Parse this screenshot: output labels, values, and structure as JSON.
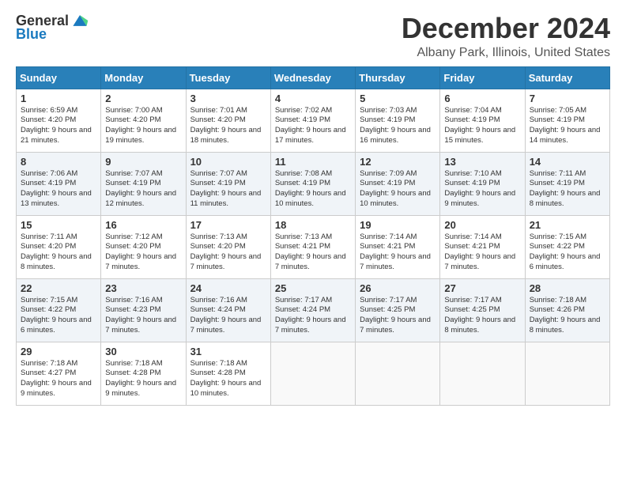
{
  "logo": {
    "general": "General",
    "blue": "Blue"
  },
  "title": "December 2024",
  "location": "Albany Park, Illinois, United States",
  "weekdays": [
    "Sunday",
    "Monday",
    "Tuesday",
    "Wednesday",
    "Thursday",
    "Friday",
    "Saturday"
  ],
  "weeks": [
    [
      {
        "day": "1",
        "sunrise": "Sunrise: 6:59 AM",
        "sunset": "Sunset: 4:20 PM",
        "daylight": "Daylight: 9 hours and 21 minutes."
      },
      {
        "day": "2",
        "sunrise": "Sunrise: 7:00 AM",
        "sunset": "Sunset: 4:20 PM",
        "daylight": "Daylight: 9 hours and 19 minutes."
      },
      {
        "day": "3",
        "sunrise": "Sunrise: 7:01 AM",
        "sunset": "Sunset: 4:20 PM",
        "daylight": "Daylight: 9 hours and 18 minutes."
      },
      {
        "day": "4",
        "sunrise": "Sunrise: 7:02 AM",
        "sunset": "Sunset: 4:19 PM",
        "daylight": "Daylight: 9 hours and 17 minutes."
      },
      {
        "day": "5",
        "sunrise": "Sunrise: 7:03 AM",
        "sunset": "Sunset: 4:19 PM",
        "daylight": "Daylight: 9 hours and 16 minutes."
      },
      {
        "day": "6",
        "sunrise": "Sunrise: 7:04 AM",
        "sunset": "Sunset: 4:19 PM",
        "daylight": "Daylight: 9 hours and 15 minutes."
      },
      {
        "day": "7",
        "sunrise": "Sunrise: 7:05 AM",
        "sunset": "Sunset: 4:19 PM",
        "daylight": "Daylight: 9 hours and 14 minutes."
      }
    ],
    [
      {
        "day": "8",
        "sunrise": "Sunrise: 7:06 AM",
        "sunset": "Sunset: 4:19 PM",
        "daylight": "Daylight: 9 hours and 13 minutes."
      },
      {
        "day": "9",
        "sunrise": "Sunrise: 7:07 AM",
        "sunset": "Sunset: 4:19 PM",
        "daylight": "Daylight: 9 hours and 12 minutes."
      },
      {
        "day": "10",
        "sunrise": "Sunrise: 7:07 AM",
        "sunset": "Sunset: 4:19 PM",
        "daylight": "Daylight: 9 hours and 11 minutes."
      },
      {
        "day": "11",
        "sunrise": "Sunrise: 7:08 AM",
        "sunset": "Sunset: 4:19 PM",
        "daylight": "Daylight: 9 hours and 10 minutes."
      },
      {
        "day": "12",
        "sunrise": "Sunrise: 7:09 AM",
        "sunset": "Sunset: 4:19 PM",
        "daylight": "Daylight: 9 hours and 10 minutes."
      },
      {
        "day": "13",
        "sunrise": "Sunrise: 7:10 AM",
        "sunset": "Sunset: 4:19 PM",
        "daylight": "Daylight: 9 hours and 9 minutes."
      },
      {
        "day": "14",
        "sunrise": "Sunrise: 7:11 AM",
        "sunset": "Sunset: 4:19 PM",
        "daylight": "Daylight: 9 hours and 8 minutes."
      }
    ],
    [
      {
        "day": "15",
        "sunrise": "Sunrise: 7:11 AM",
        "sunset": "Sunset: 4:20 PM",
        "daylight": "Daylight: 9 hours and 8 minutes."
      },
      {
        "day": "16",
        "sunrise": "Sunrise: 7:12 AM",
        "sunset": "Sunset: 4:20 PM",
        "daylight": "Daylight: 9 hours and 7 minutes."
      },
      {
        "day": "17",
        "sunrise": "Sunrise: 7:13 AM",
        "sunset": "Sunset: 4:20 PM",
        "daylight": "Daylight: 9 hours and 7 minutes."
      },
      {
        "day": "18",
        "sunrise": "Sunrise: 7:13 AM",
        "sunset": "Sunset: 4:21 PM",
        "daylight": "Daylight: 9 hours and 7 minutes."
      },
      {
        "day": "19",
        "sunrise": "Sunrise: 7:14 AM",
        "sunset": "Sunset: 4:21 PM",
        "daylight": "Daylight: 9 hours and 7 minutes."
      },
      {
        "day": "20",
        "sunrise": "Sunrise: 7:14 AM",
        "sunset": "Sunset: 4:21 PM",
        "daylight": "Daylight: 9 hours and 7 minutes."
      },
      {
        "day": "21",
        "sunrise": "Sunrise: 7:15 AM",
        "sunset": "Sunset: 4:22 PM",
        "daylight": "Daylight: 9 hours and 6 minutes."
      }
    ],
    [
      {
        "day": "22",
        "sunrise": "Sunrise: 7:15 AM",
        "sunset": "Sunset: 4:22 PM",
        "daylight": "Daylight: 9 hours and 6 minutes."
      },
      {
        "day": "23",
        "sunrise": "Sunrise: 7:16 AM",
        "sunset": "Sunset: 4:23 PM",
        "daylight": "Daylight: 9 hours and 7 minutes."
      },
      {
        "day": "24",
        "sunrise": "Sunrise: 7:16 AM",
        "sunset": "Sunset: 4:24 PM",
        "daylight": "Daylight: 9 hours and 7 minutes."
      },
      {
        "day": "25",
        "sunrise": "Sunrise: 7:17 AM",
        "sunset": "Sunset: 4:24 PM",
        "daylight": "Daylight: 9 hours and 7 minutes."
      },
      {
        "day": "26",
        "sunrise": "Sunrise: 7:17 AM",
        "sunset": "Sunset: 4:25 PM",
        "daylight": "Daylight: 9 hours and 7 minutes."
      },
      {
        "day": "27",
        "sunrise": "Sunrise: 7:17 AM",
        "sunset": "Sunset: 4:25 PM",
        "daylight": "Daylight: 9 hours and 8 minutes."
      },
      {
        "day": "28",
        "sunrise": "Sunrise: 7:18 AM",
        "sunset": "Sunset: 4:26 PM",
        "daylight": "Daylight: 9 hours and 8 minutes."
      }
    ],
    [
      {
        "day": "29",
        "sunrise": "Sunrise: 7:18 AM",
        "sunset": "Sunset: 4:27 PM",
        "daylight": "Daylight: 9 hours and 9 minutes."
      },
      {
        "day": "30",
        "sunrise": "Sunrise: 7:18 AM",
        "sunset": "Sunset: 4:28 PM",
        "daylight": "Daylight: 9 hours and 9 minutes."
      },
      {
        "day": "31",
        "sunrise": "Sunrise: 7:18 AM",
        "sunset": "Sunset: 4:28 PM",
        "daylight": "Daylight: 9 hours and 10 minutes."
      },
      {
        "day": "",
        "sunrise": "",
        "sunset": "",
        "daylight": ""
      },
      {
        "day": "",
        "sunrise": "",
        "sunset": "",
        "daylight": ""
      },
      {
        "day": "",
        "sunrise": "",
        "sunset": "",
        "daylight": ""
      },
      {
        "day": "",
        "sunrise": "",
        "sunset": "",
        "daylight": ""
      }
    ]
  ]
}
